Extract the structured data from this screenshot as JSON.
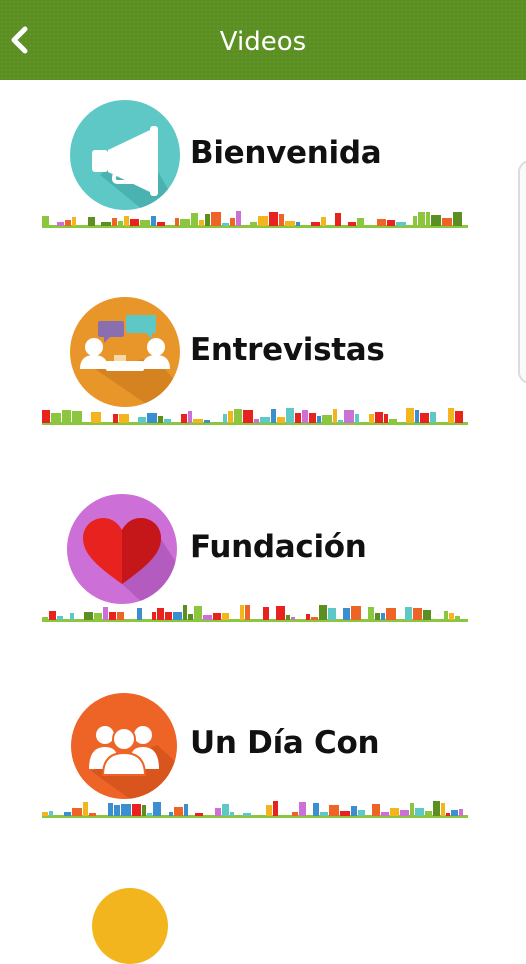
{
  "app_bar": {
    "title": "Videos",
    "back_icon": "chevron-left-icon",
    "color": "#5b8f22"
  },
  "items": [
    {
      "label": "Bienvenida",
      "icon": "megaphone-icon",
      "color": "#5ec8c6"
    },
    {
      "label": "Entrevistas",
      "icon": "interview-icon",
      "color": "#e8962a"
    },
    {
      "label": "Fundación",
      "icon": "heart-icon",
      "color": "#cc6fd6"
    },
    {
      "label": "Un Día Con",
      "icon": "people-group-icon",
      "color": "#ee6426"
    },
    {
      "label": "",
      "icon": "partial-icon",
      "color": "#f2b51d"
    }
  ]
}
